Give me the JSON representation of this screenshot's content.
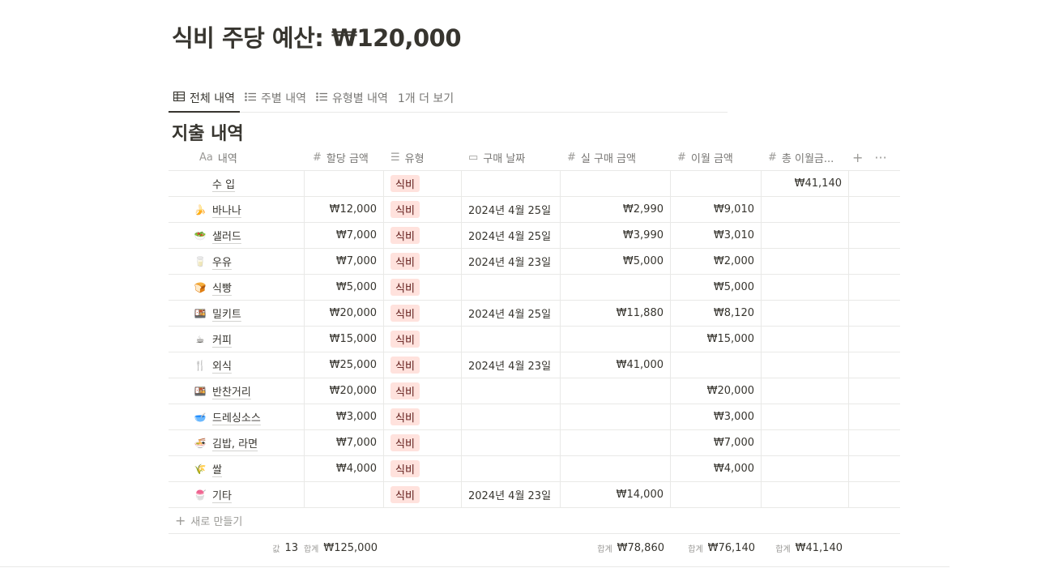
{
  "title": "식비 주당 예산: ₩120,000",
  "tabs": [
    {
      "label": "전체 내역",
      "icon": "table-icon",
      "active": true
    },
    {
      "label": "주별 내역",
      "icon": "list-icon",
      "active": false
    },
    {
      "label": "유형별 내역",
      "icon": "list-icon",
      "active": false
    },
    {
      "label": "1개 더 보기",
      "icon": "",
      "active": false
    }
  ],
  "section_title": "지출 내역",
  "columns": {
    "name": {
      "label": "내역",
      "icon_text": "Aa"
    },
    "alloc": {
      "label": "할당 금액",
      "icon_text": "#"
    },
    "type": {
      "label": "유형",
      "icon_text": "☰"
    },
    "date": {
      "label": "구매 날짜",
      "icon_text": "▭"
    },
    "actual": {
      "label": "실 구매 금액",
      "icon_text": "#"
    },
    "carry": {
      "label": "이월 금액",
      "icon_text": "#"
    },
    "total_carry": {
      "label": "총 이월금...",
      "icon_text": "#"
    }
  },
  "header_actions": {
    "add": "+",
    "more": "···"
  },
  "rows": [
    {
      "emoji": "",
      "name": "수    입",
      "alloc": "",
      "type": "식비",
      "date": "",
      "actual": "",
      "carry": "",
      "total": "₩41,140"
    },
    {
      "emoji": "🍌",
      "name": "바나나",
      "alloc": "₩12,000",
      "type": "식비",
      "date": "2024년 4월 25일",
      "actual": "₩2,990",
      "carry": "₩9,010",
      "total": ""
    },
    {
      "emoji": "🥗",
      "name": "샐러드",
      "alloc": "₩7,000",
      "type": "식비",
      "date": "2024년 4월 25일",
      "actual": "₩3,990",
      "carry": "₩3,010",
      "total": ""
    },
    {
      "emoji": "🥛",
      "name": "우유",
      "alloc": "₩7,000",
      "type": "식비",
      "date": "2024년 4월 23일",
      "actual": "₩5,000",
      "carry": "₩2,000",
      "total": ""
    },
    {
      "emoji": "🍞",
      "name": "식빵",
      "alloc": "₩5,000",
      "type": "식비",
      "date": "",
      "actual": "",
      "carry": "₩5,000",
      "total": ""
    },
    {
      "emoji": "🍱",
      "name": "밀키트",
      "alloc": "₩20,000",
      "type": "식비",
      "date": "2024년 4월 25일",
      "actual": "₩11,880",
      "carry": "₩8,120",
      "total": ""
    },
    {
      "emoji": "☕",
      "name": "커피",
      "alloc": "₩15,000",
      "type": "식비",
      "date": "",
      "actual": "",
      "carry": "₩15,000",
      "total": ""
    },
    {
      "emoji": "🍴",
      "name": "외식",
      "alloc": "₩25,000",
      "type": "식비",
      "date": "2024년 4월 23일",
      "actual": "₩41,000",
      "carry": "",
      "total": ""
    },
    {
      "emoji": "🍱",
      "name": "반찬거리",
      "alloc": "₩20,000",
      "type": "식비",
      "date": "",
      "actual": "",
      "carry": "₩20,000",
      "total": ""
    },
    {
      "emoji": "🥣",
      "name": "드레싱소스",
      "alloc": "₩3,000",
      "type": "식비",
      "date": "",
      "actual": "",
      "carry": "₩3,000",
      "total": ""
    },
    {
      "emoji": "🍜",
      "name": "김밥, 라면",
      "alloc": "₩7,000",
      "type": "식비",
      "date": "",
      "actual": "",
      "carry": "₩7,000",
      "total": ""
    },
    {
      "emoji": "🌾",
      "name": "쌀",
      "alloc": "₩4,000",
      "type": "식비",
      "date": "",
      "actual": "",
      "carry": "₩4,000",
      "total": ""
    },
    {
      "emoji": "🍧",
      "name": "기타",
      "alloc": "",
      "type": "식비",
      "date": "2024년 4월 23일",
      "actual": "₩14,000",
      "carry": "",
      "total": ""
    }
  ],
  "new_row_label": "새로 만들기",
  "footer": {
    "count_label": "값",
    "count_value": "13",
    "alloc_label": "합계",
    "alloc_value": "₩125,000",
    "actual_label": "합계",
    "actual_value": "₩78,860",
    "carry_label": "합계",
    "carry_value": "₩76,140",
    "total_label": "합계",
    "total_value": "₩41,140"
  },
  "colors": {
    "tag_bg": "#ffe2dd",
    "tag_text": "#5d1715",
    "border": "#e9e9e7",
    "muted": "#787774"
  }
}
